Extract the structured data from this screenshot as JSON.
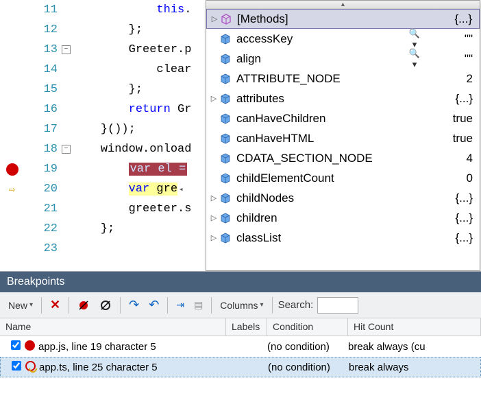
{
  "editor": {
    "lines": [
      {
        "n": 11,
        "indent": "            ",
        "pre": "",
        "kw": "this",
        "post": "."
      },
      {
        "n": 12,
        "indent": "        ",
        "pre": "};",
        "kw": "",
        "post": ""
      },
      {
        "n": 13,
        "indent": "        ",
        "pre": "Greeter.p",
        "kw": "",
        "post": ""
      },
      {
        "n": 14,
        "indent": "            ",
        "pre": "clear",
        "kw": "",
        "post": ""
      },
      {
        "n": 15,
        "indent": "        ",
        "pre": "};",
        "kw": "",
        "post": ""
      },
      {
        "n": 16,
        "indent": "        ",
        "pre": "",
        "kw": "return",
        "post": " Gr"
      },
      {
        "n": 17,
        "indent": "    ",
        "pre": "}());",
        "kw": "",
        "post": ""
      },
      {
        "n": 18,
        "indent": "    ",
        "pre": "window.onload",
        "kw": "",
        "post": ""
      },
      {
        "n": 19,
        "indent": "        ",
        "pre": "",
        "kw": "",
        "post": "",
        "hlred": "var el ="
      },
      {
        "n": 20,
        "indent": "        ",
        "pre": "",
        "kw": "",
        "post": "",
        "hlyellow_kw": "var",
        "hlyellow_rest": " gre"
      },
      {
        "n": 21,
        "indent": "        ",
        "pre": "greeter.s",
        "kw": "",
        "post": ""
      },
      {
        "n": 22,
        "indent": "    ",
        "pre": "};",
        "kw": "",
        "post": ""
      },
      {
        "n": 23,
        "indent": "",
        "pre": "",
        "kw": "",
        "post": ""
      }
    ],
    "outline": {
      "13": "-",
      "18": "-"
    },
    "breakpointAtLine": 19,
    "currentLine": 20
  },
  "intellisense": {
    "items": [
      {
        "expand": "▷",
        "icon": "methods",
        "label": "[Methods]",
        "value": "{...}",
        "extra": "",
        "selected": true
      },
      {
        "expand": "",
        "icon": "cube",
        "label": "accessKey",
        "value": "\"\"",
        "extra": "🔍 ▾"
      },
      {
        "expand": "",
        "icon": "cube",
        "label": "align",
        "value": "\"\"",
        "extra": "🔍 ▾"
      },
      {
        "expand": "",
        "icon": "cube",
        "label": "ATTRIBUTE_NODE",
        "value": "2",
        "extra": ""
      },
      {
        "expand": "▷",
        "icon": "cube",
        "label": "attributes",
        "value": "{...}",
        "extra": ""
      },
      {
        "expand": "",
        "icon": "cube",
        "label": "canHaveChildren",
        "value": "true",
        "extra": ""
      },
      {
        "expand": "",
        "icon": "cube",
        "label": "canHaveHTML",
        "value": "true",
        "extra": ""
      },
      {
        "expand": "",
        "icon": "cube",
        "label": "CDATA_SECTION_NODE",
        "value": "4",
        "extra": ""
      },
      {
        "expand": "",
        "icon": "cube",
        "label": "childElementCount",
        "value": "0",
        "extra": ""
      },
      {
        "expand": "▷",
        "icon": "cube",
        "label": "childNodes",
        "value": "{...}",
        "extra": ""
      },
      {
        "expand": "▷",
        "icon": "cube",
        "label": "children",
        "value": "{...}",
        "extra": ""
      },
      {
        "expand": "▷",
        "icon": "cube",
        "label": "classList",
        "value": "{...}",
        "extra": ""
      }
    ],
    "popup_collapse": "◂"
  },
  "breakpointsPanel": {
    "title": "Breakpoints",
    "toolbar": {
      "new": "New",
      "columns": "Columns",
      "search": "Search:",
      "searchValue": ""
    },
    "headers": {
      "name": "Name",
      "labels": "Labels",
      "condition": "Condition",
      "hit": "Hit Count"
    },
    "rows": [
      {
        "checked": true,
        "icon": "red",
        "name": "app.js, line 19 character 5",
        "labels": "",
        "condition": "(no condition)",
        "hit": "break always (cu",
        "selected": false
      },
      {
        "checked": true,
        "icon": "mapped",
        "name": "app.ts, line 25 character 5",
        "labels": "",
        "condition": "(no condition)",
        "hit": "break always",
        "selected": true
      }
    ]
  }
}
